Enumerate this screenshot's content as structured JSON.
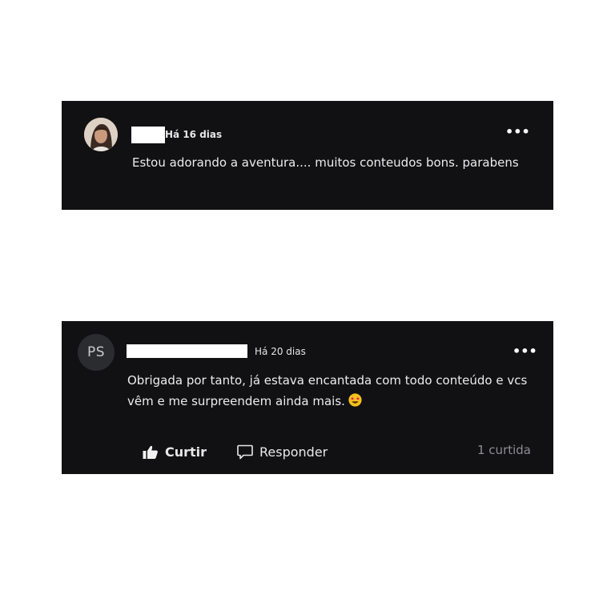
{
  "comments": [
    {
      "time": "Há 16 dias",
      "body": "Estou adorando a aventura.... muitos conteudos bons. parabens",
      "menu_icon": "more-horizontal-icon"
    },
    {
      "avatar_initials": "PS",
      "time": "Há 20 dias",
      "body": "Obrigada por tanto, já estava encantada com todo conteúdo e vcs vêm e me surpreendem ainda mais.",
      "emoji": "star-struck-emoji",
      "menu_icon": "more-horizontal-icon",
      "actions": {
        "like_label": "Curtir",
        "reply_label": "Responder"
      },
      "like_count": "1 curtida"
    }
  ],
  "colors": {
    "card_bg": "#111113",
    "text": "#ececec",
    "muted": "#8e8e93",
    "avatar_bg": "#2b2c30"
  }
}
